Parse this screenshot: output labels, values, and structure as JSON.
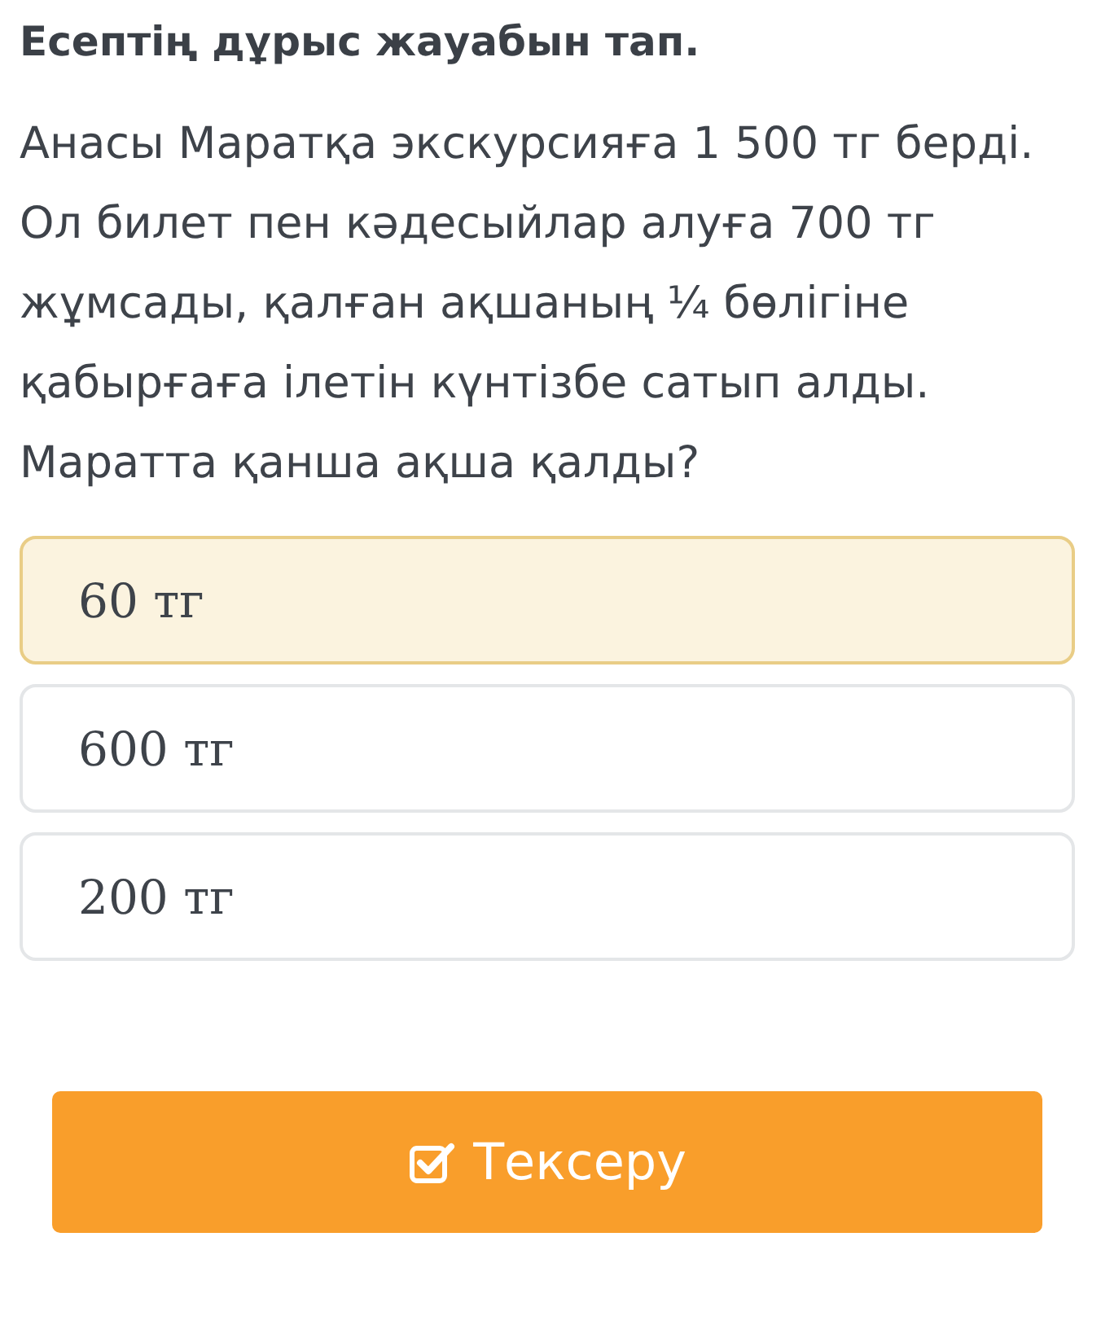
{
  "title": "Есептің дұрыс жауабын тап.",
  "question": "Анасы Маратқа экскурсияға 1 500 тг берді. Ол билет пен кәдесыйлар алуға 700 тг жұмсады, қалған ақшаның ¼ бөлігіне қабырғаға ілетін күнтізбе сатып алды. Маратта қанша ақша қалды?",
  "options": [
    {
      "label": "60 тг",
      "selected": true
    },
    {
      "label": "600 тг",
      "selected": false
    },
    {
      "label": "200 тг",
      "selected": false
    }
  ],
  "check_button": {
    "label": "Тексеру"
  }
}
